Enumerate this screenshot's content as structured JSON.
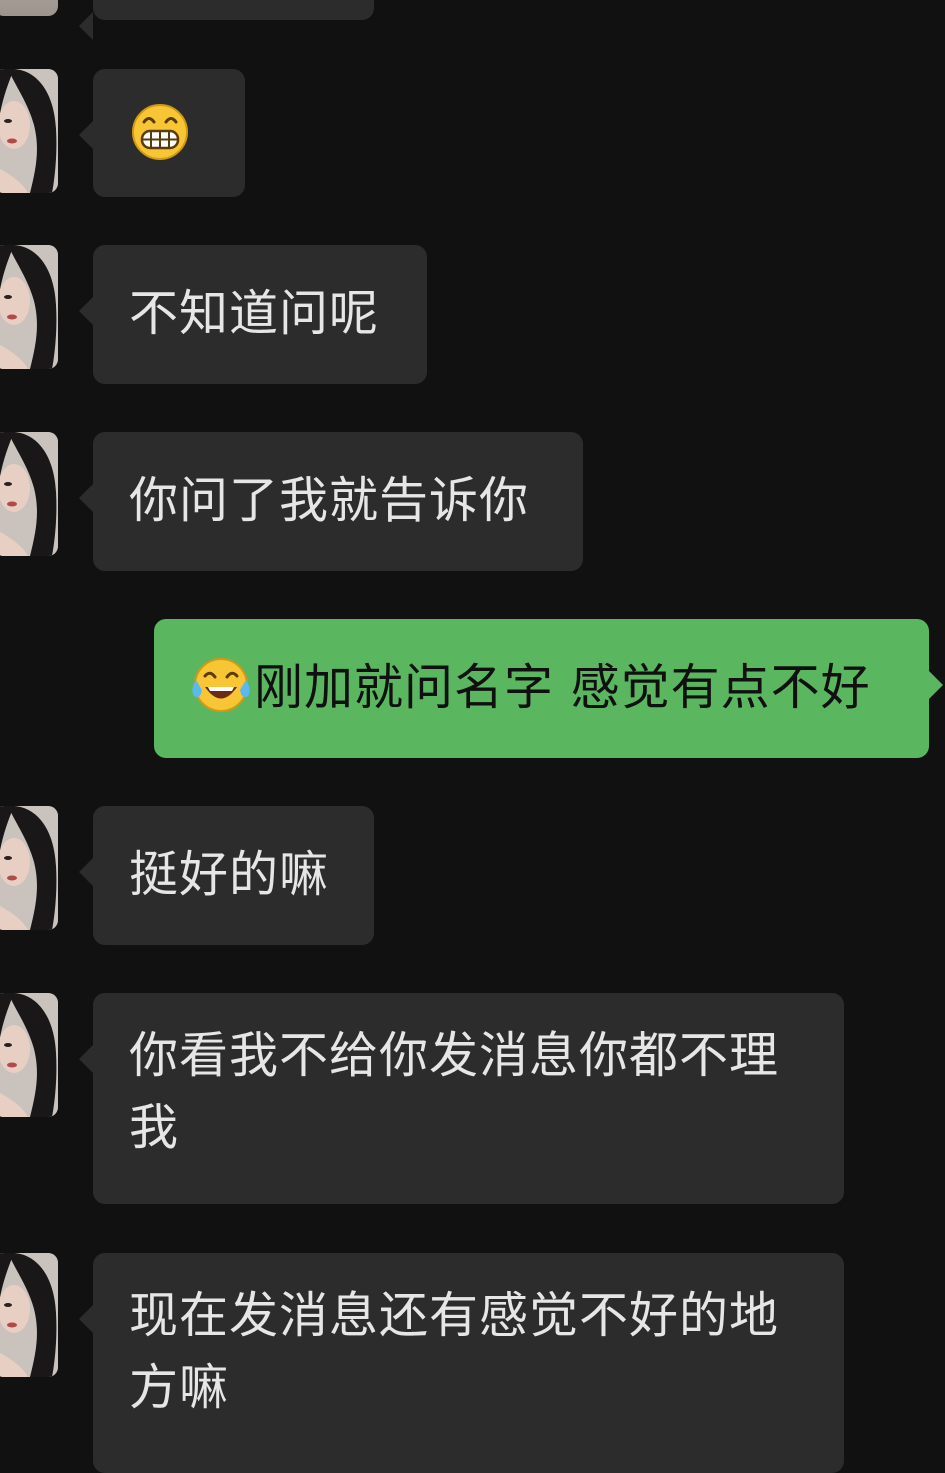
{
  "messages": [
    {
      "side": "in",
      "avatar": "contact-avatar",
      "text": "",
      "emoji": "grinning-face-icon"
    },
    {
      "side": "in",
      "avatar": "contact-avatar",
      "text": "不知道问呢"
    },
    {
      "side": "in",
      "avatar": "contact-avatar",
      "text": "你问了我就告诉你"
    },
    {
      "side": "out",
      "text": "刚加就问名字 感觉有点不好",
      "emoji": "tears-of-joy-icon"
    },
    {
      "side": "in",
      "avatar": "contact-avatar",
      "text": "挺好的嘛"
    },
    {
      "side": "in",
      "avatar": "contact-avatar",
      "text": "你看我不给你发消息你都不理我"
    },
    {
      "side": "in",
      "avatar": "contact-avatar",
      "text": "现在发消息还有感觉不好的地方嘛"
    }
  ],
  "colors": {
    "background": "#111111",
    "incoming_bubble": "#2c2c2c",
    "outgoing_bubble": "#5ab760",
    "incoming_text": "#e6e6e6",
    "outgoing_text": "#101010"
  }
}
